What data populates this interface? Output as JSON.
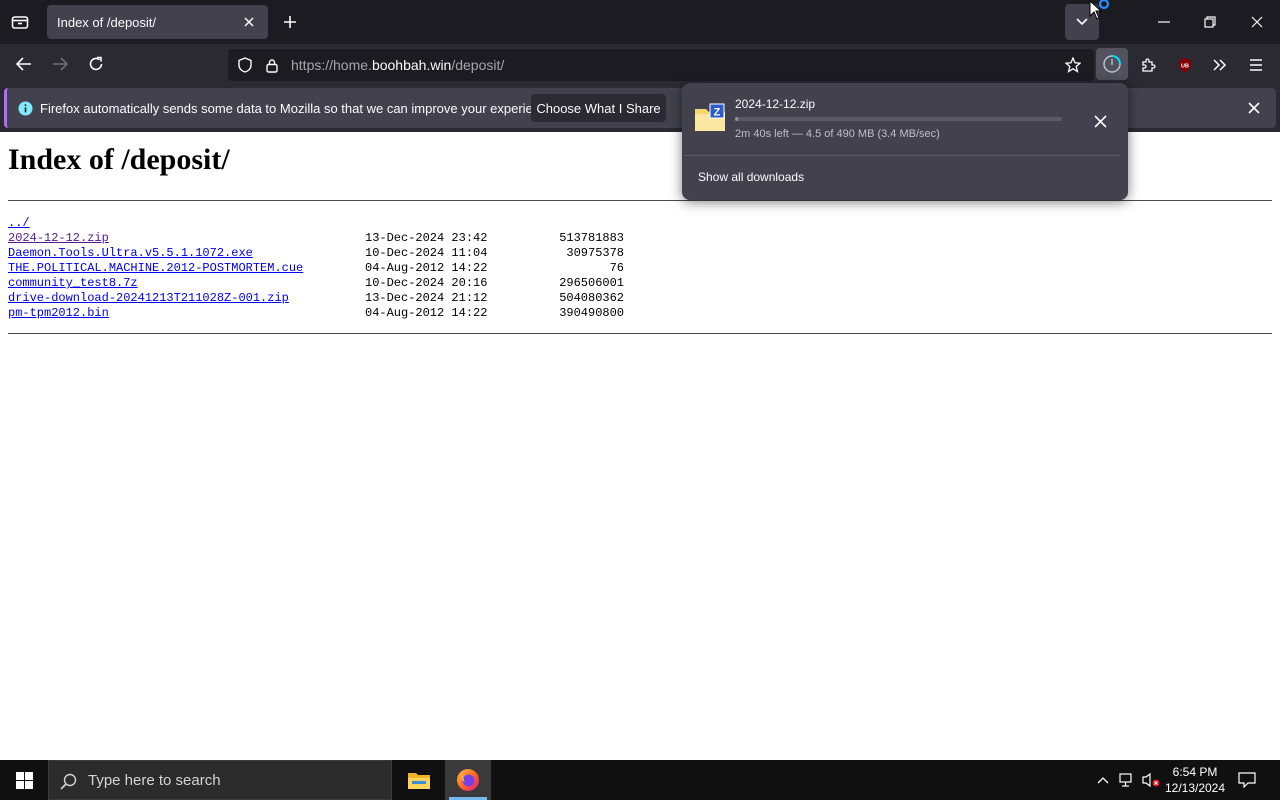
{
  "browser": {
    "tab_title": "Index of /deposit/",
    "url_prefix": "https://home.",
    "url_host": "boohbah.win",
    "url_path": "/deposit/",
    "notification_text": "Firefox automatically sends some data to Mozilla so that we can improve your experience.",
    "notification_button": "Choose What I Share"
  },
  "page": {
    "title": "Index of /deposit/",
    "parent_link": "../",
    "files": [
      {
        "name": "2024-12-12.zip",
        "date": "13-Dec-2024 23:42",
        "size": "513781883",
        "visited": true
      },
      {
        "name": "Daemon.Tools.Ultra.v5.5.1.1072.exe",
        "date": "10-Dec-2024 11:04",
        "size": "30975378",
        "visited": false
      },
      {
        "name": "THE.POLITICAL.MACHINE.2012-POSTMORTEM.cue",
        "date": "04-Aug-2012 14:22",
        "size": "76",
        "visited": false
      },
      {
        "name": "community_test8.7z",
        "date": "10-Dec-2024 20:16",
        "size": "296506001",
        "visited": false
      },
      {
        "name": "drive-download-20241213T211028Z-001.zip",
        "date": "13-Dec-2024 21:12",
        "size": "504080362",
        "visited": false
      },
      {
        "name": "pm-tpm2012.bin",
        "date": "04-Aug-2012 14:22",
        "size": "390490800",
        "visited": false
      }
    ]
  },
  "downloads": {
    "file_name": "2024-12-12.zip",
    "status": "2m 40s left — 4.5 of 490 MB (3.4 MB/sec)",
    "progress_fraction": 0.01,
    "show_all": "Show all downloads"
  },
  "taskbar": {
    "search_placeholder": "Type here to search",
    "time": "6:54 PM",
    "date": "12/13/2024"
  },
  "colors": {
    "tab_strip": "#1c1b22",
    "toolbar": "#2b2a33",
    "link": "#0000ee",
    "visited_link": "#551a8b",
    "notification_accent": "#b36bff"
  }
}
